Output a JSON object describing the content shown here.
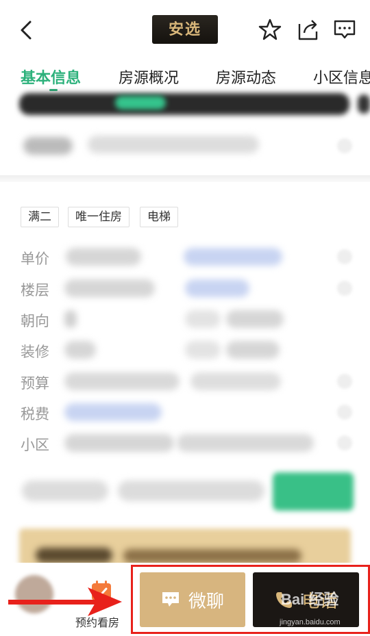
{
  "header": {
    "badge_text": "安选",
    "icons": [
      "back-arrow-icon",
      "star-icon",
      "share-icon",
      "message-icon"
    ]
  },
  "tabs": [
    {
      "label": "基本信息",
      "active": true
    },
    {
      "label": "房源概况",
      "active": false
    },
    {
      "label": "房源动态",
      "active": false
    },
    {
      "label": "小区信息",
      "active": false
    }
  ],
  "tags": [
    "满二",
    "唯一住房",
    "电梯"
  ],
  "info_rows": [
    {
      "label": "单价"
    },
    {
      "label": "楼层"
    },
    {
      "label": "朝向"
    },
    {
      "label": "装修"
    },
    {
      "label": "预算"
    },
    {
      "label": "税费"
    },
    {
      "label": "小区"
    }
  ],
  "bottom_bar": {
    "appointment_label": "预约看房",
    "chat_label": "微聊",
    "call_label": "电话"
  },
  "colors": {
    "accent_green": "#2cb17b",
    "gold": "#d7b57f",
    "dark": "#1b1714",
    "annotation_red": "#e8211b"
  },
  "watermark": {
    "brand": "Bai 经验",
    "url": "jingyan.baidu.com"
  }
}
